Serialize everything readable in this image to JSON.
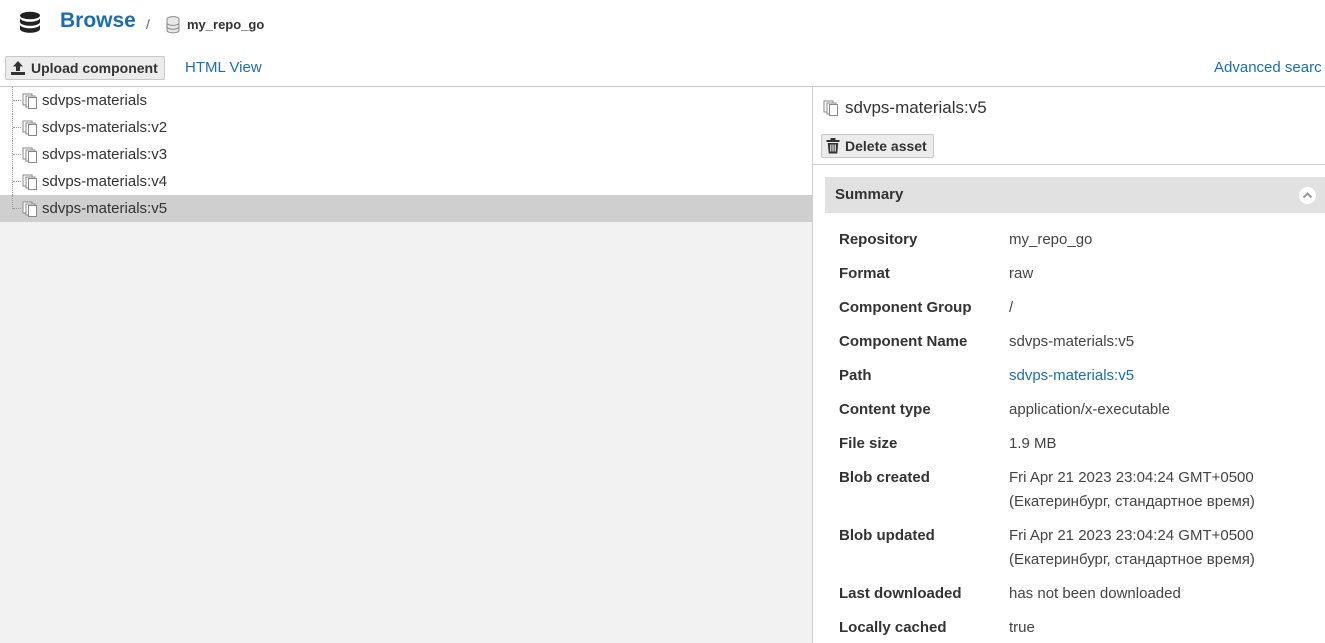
{
  "header": {
    "title": "Browse",
    "separator": "/",
    "repository": "my_repo_go"
  },
  "toolbar": {
    "upload_label": "Upload component",
    "html_view_label": "HTML View",
    "advanced_search_label": "Advanced searc"
  },
  "tree": {
    "items": [
      {
        "label": "sdvps-materials"
      },
      {
        "label": "sdvps-materials:v2"
      },
      {
        "label": "sdvps-materials:v3"
      },
      {
        "label": "sdvps-materials:v4"
      },
      {
        "label": "sdvps-materials:v5"
      }
    ],
    "selected_index": 4
  },
  "detail": {
    "asset_name": "sdvps-materials:v5",
    "delete_label": "Delete asset",
    "summary_title": "Summary",
    "fields": [
      {
        "key": "Repository",
        "value": "my_repo_go"
      },
      {
        "key": "Format",
        "value": "raw"
      },
      {
        "key": "Component Group",
        "value": "/"
      },
      {
        "key": "Component Name",
        "value": "sdvps-materials:v5"
      },
      {
        "key": "Path",
        "value": "sdvps-materials:v5"
      },
      {
        "key": "Content type",
        "value": "application/x-executable"
      },
      {
        "key": "File size",
        "value": "1.9 MB"
      },
      {
        "key": "Blob created",
        "value": "Fri Apr 21 2023 23:04:24 GMT+0500 (Екатеринбург, стандартное время)"
      },
      {
        "key": "Blob updated",
        "value": "Fri Apr 21 2023 23:04:24 GMT+0500 (Екатеринбург, стандартное время)"
      },
      {
        "key": "Last downloaded",
        "value": "has not been downloaded"
      },
      {
        "key": "Locally cached",
        "value": "true"
      }
    ]
  },
  "colors": {
    "accent": "#1a6db5",
    "selected_row": "#cfcfcf",
    "summary_bar": "#e1e1e1"
  }
}
